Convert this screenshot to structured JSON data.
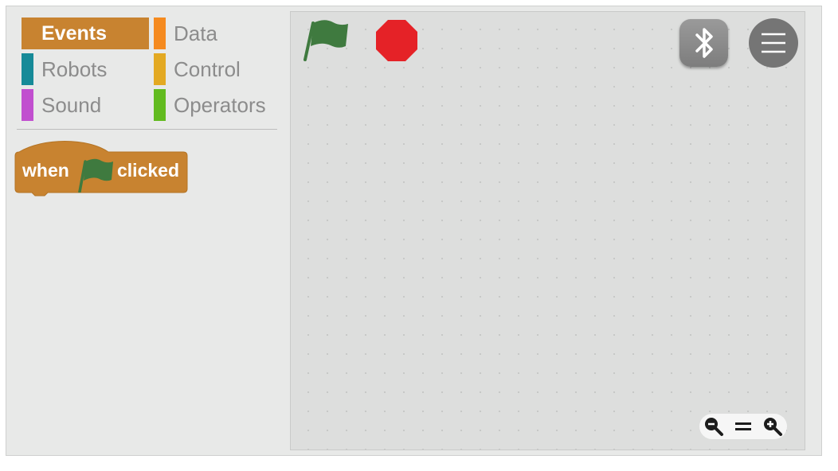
{
  "palette": {
    "categories": [
      {
        "label": "Events",
        "color": "#c88330",
        "selected": true
      },
      {
        "label": "Data",
        "color": "#f58a1f",
        "selected": false
      },
      {
        "label": "Robots",
        "color": "#168a98",
        "selected": false
      },
      {
        "label": "Control",
        "color": "#e3a922",
        "selected": false
      },
      {
        "label": "Sound",
        "color": "#c14fcf",
        "selected": false
      },
      {
        "label": "Operators",
        "color": "#62bb1f",
        "selected": false
      }
    ],
    "blocks": {
      "when_flag_clicked": {
        "word_before": "when",
        "icon": "green-flag-icon",
        "word_after": "clicked",
        "color": "#c88330"
      }
    }
  },
  "stage": {
    "controls": {
      "run": {
        "icon": "green-flag-icon",
        "color": "#3f7a3f"
      },
      "stop": {
        "icon": "stop-sign-icon",
        "color": "#e52227"
      },
      "bluetooth": {
        "icon": "bluetooth-icon"
      },
      "menu": {
        "icon": "hamburger-menu-icon"
      }
    },
    "zoom": {
      "zoom_out": {
        "icon": "zoom-out-icon"
      },
      "reset": {
        "icon": "equals-icon"
      },
      "zoom_in": {
        "icon": "zoom-in-icon"
      }
    }
  }
}
